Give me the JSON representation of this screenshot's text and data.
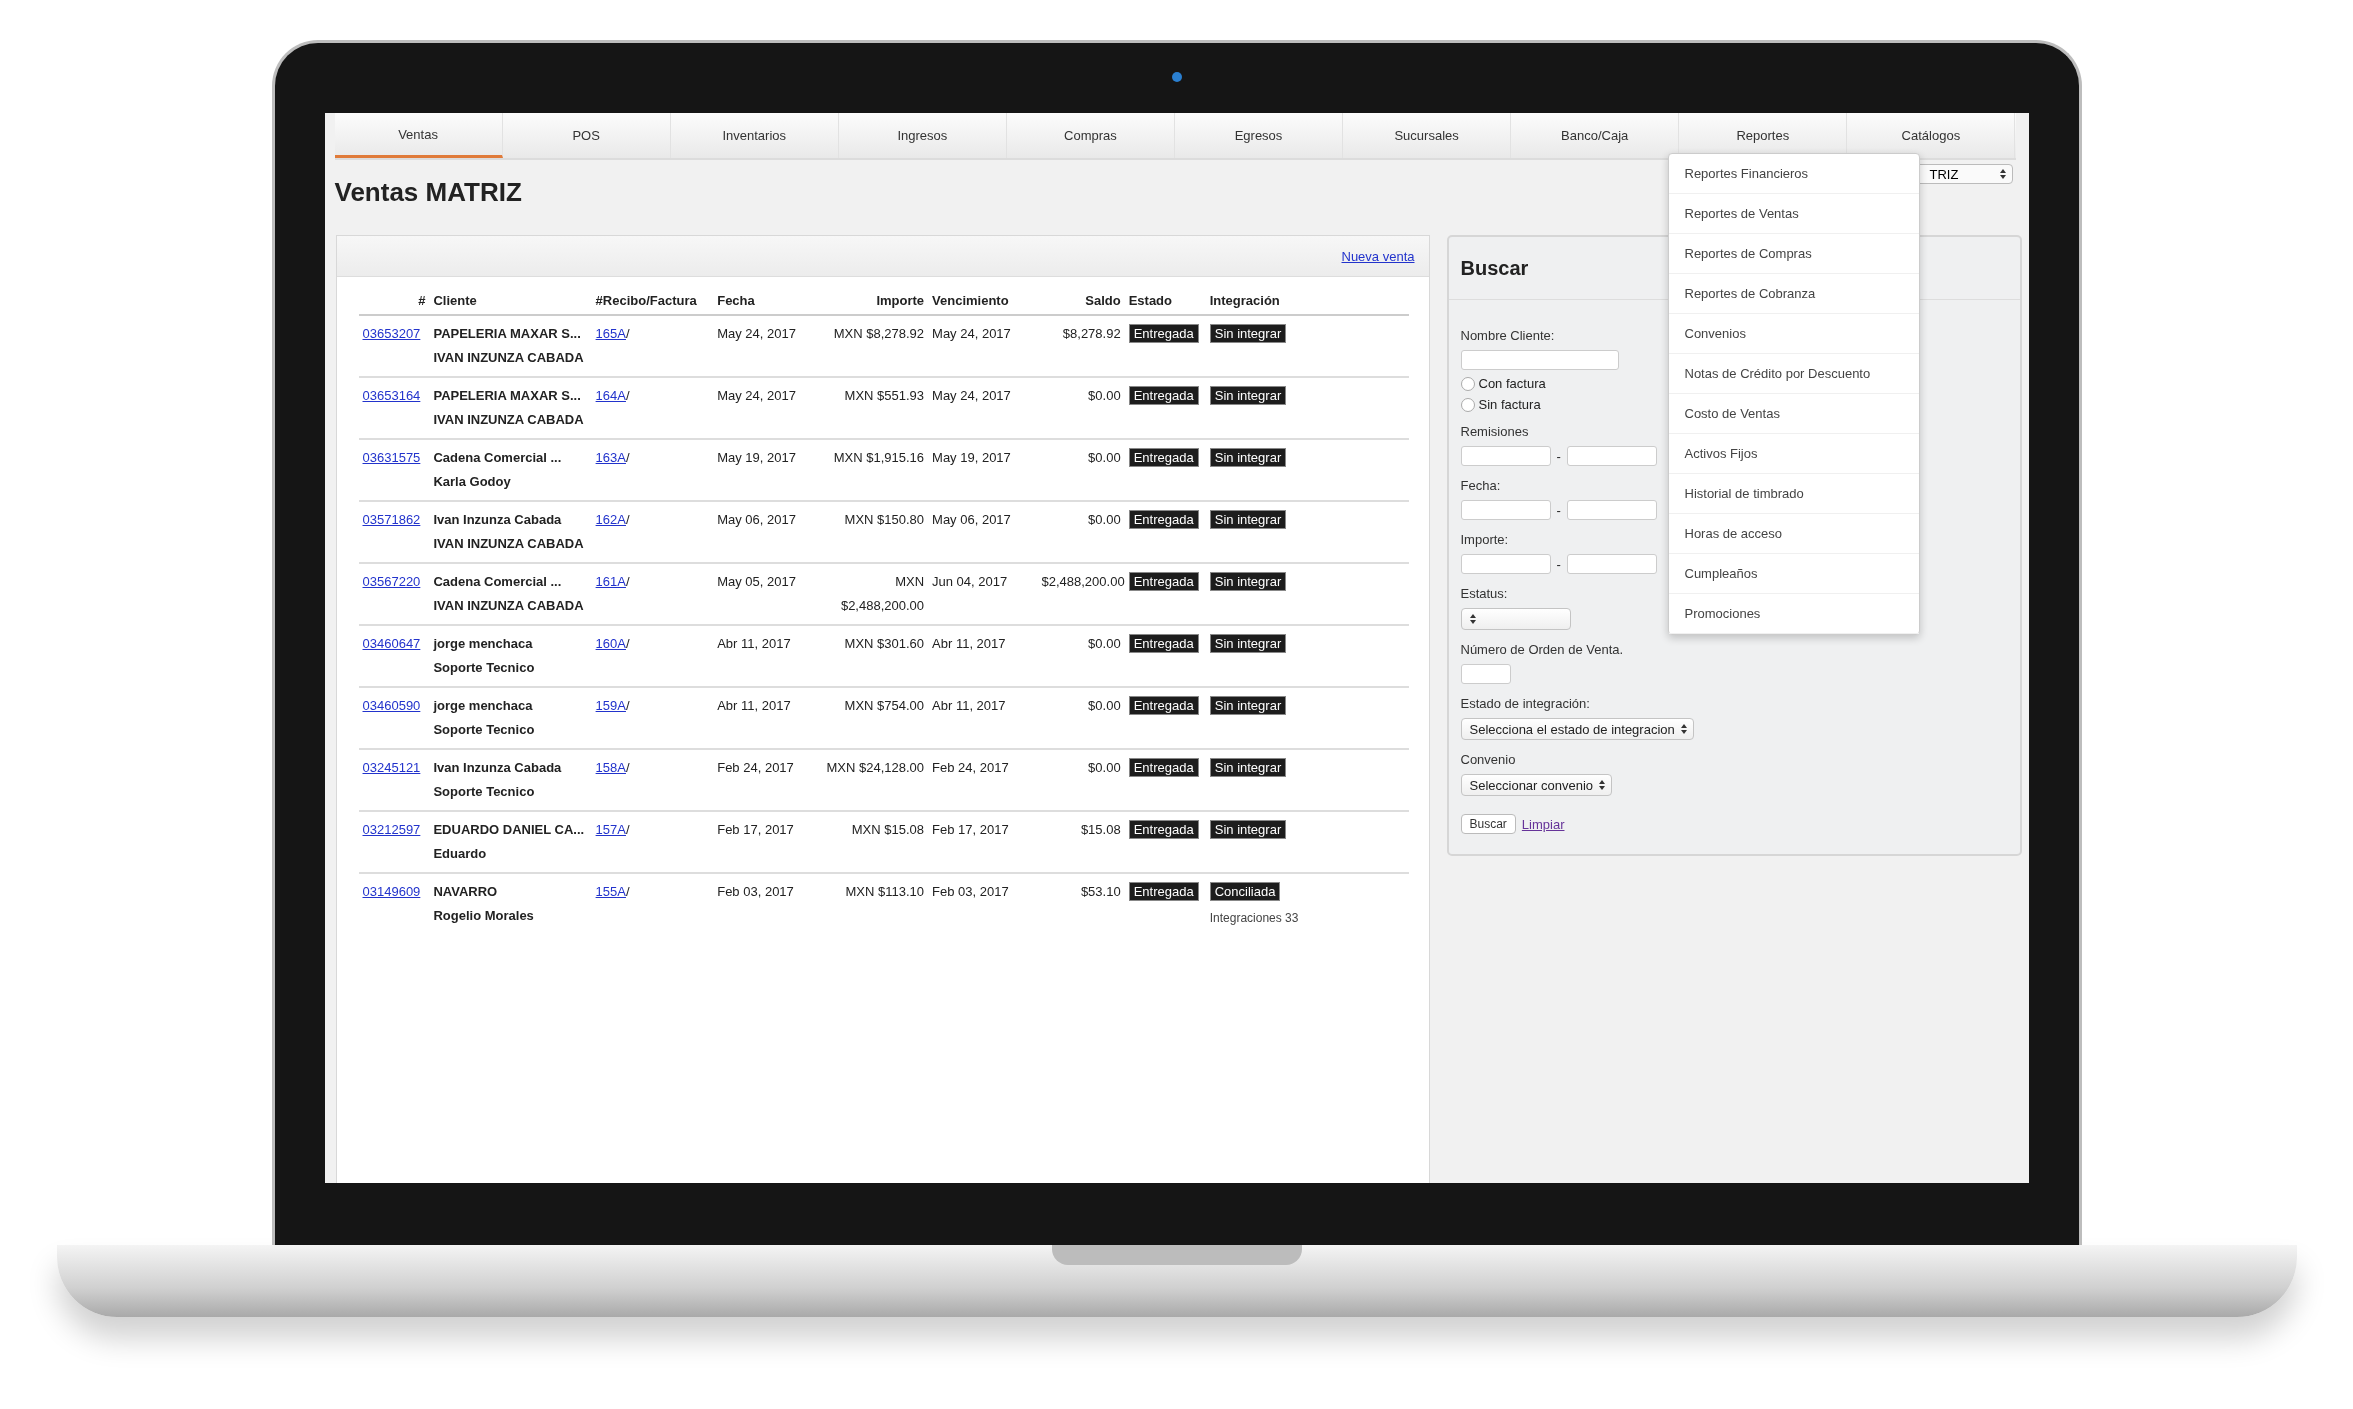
{
  "tabs": [
    {
      "label": "Ventas",
      "selected": true
    },
    {
      "label": "POS",
      "selected": false
    },
    {
      "label": "Inventarios",
      "selected": false
    },
    {
      "label": "Ingresos",
      "selected": false
    },
    {
      "label": "Compras",
      "selected": false
    },
    {
      "label": "Egresos",
      "selected": false
    },
    {
      "label": "Sucursales",
      "selected": false
    },
    {
      "label": "Banco/Caja",
      "selected": false
    },
    {
      "label": "Reportes",
      "selected": false
    },
    {
      "label": "Catálogos",
      "selected": false
    }
  ],
  "page_title": "Ventas MATRIZ",
  "branch_select": {
    "value": "TRIZ"
  },
  "reportes_menu": [
    "Reportes Financieros",
    "Reportes de Ventas",
    "Reportes de Compras",
    "Reportes de Cobranza",
    "Convenios",
    "Notas de Crédito por Descuento",
    "Costo de Ventas",
    "Activos Fijos",
    "Historial de timbrado",
    "Horas de acceso",
    "Cumpleaños",
    "Promociones"
  ],
  "sales_panel": {
    "new_sale_link": "Nueva venta",
    "columns": [
      "#",
      "Cliente",
      "#Recibo/Factura",
      "Fecha",
      "Importe",
      "Vencimiento",
      "Saldo",
      "Estado",
      "Integración"
    ],
    "rows": [
      {
        "id": "03653207",
        "cliente": [
          "PAPELERIA MAXAR S...",
          "IVAN INZUNZA CABADA"
        ],
        "recibo": "165A",
        "sep": "/",
        "fecha": "May 24, 2017",
        "importe": "MXN $8,278.92",
        "vencimiento": "May 24, 2017",
        "saldo": "$8,278.92",
        "estado": "Entregada",
        "integracion": "Sin integrar"
      },
      {
        "id": "03653164",
        "cliente": [
          "PAPELERIA MAXAR S...",
          "IVAN INZUNZA CABADA"
        ],
        "recibo": "164A",
        "sep": "/",
        "fecha": "May 24, 2017",
        "importe": "MXN $551.93",
        "vencimiento": "May 24, 2017",
        "saldo": "$0.00",
        "estado": "Entregada",
        "integracion": "Sin integrar"
      },
      {
        "id": "03631575",
        "cliente": [
          "Cadena Comercial ...",
          "Karla Godoy"
        ],
        "recibo": "163A",
        "sep": "/",
        "fecha": "May 19, 2017",
        "importe": "MXN $1,915.16",
        "vencimiento": "May 19, 2017",
        "saldo": "$0.00",
        "estado": "Entregada",
        "integracion": "Sin integrar"
      },
      {
        "id": "03571862",
        "cliente": [
          "Ivan Inzunza Cabada",
          "IVAN INZUNZA CABADA"
        ],
        "recibo": "162A",
        "sep": "/",
        "fecha": "May 06, 2017",
        "importe": "MXN $150.80",
        "vencimiento": "May 06, 2017",
        "saldo": "$0.00",
        "estado": "Entregada",
        "integracion": "Sin integrar"
      },
      {
        "id": "03567220",
        "cliente": [
          "Cadena Comercial ...",
          "IVAN INZUNZA CABADA"
        ],
        "recibo": "161A",
        "sep": "/",
        "fecha": "May 05, 2017",
        "importe": "MXN $2,488,200.00",
        "vencimiento": "Jun 04, 2017",
        "saldo": "$2,488,200.00",
        "estado": "Entregada",
        "integracion": "Sin integrar"
      },
      {
        "id": "03460647",
        "cliente": [
          "jorge menchaca",
          "Soporte Tecnico"
        ],
        "recibo": "160A",
        "sep": "/",
        "fecha": "Abr 11, 2017",
        "importe": "MXN $301.60",
        "vencimiento": "Abr 11, 2017",
        "saldo": "$0.00",
        "estado": "Entregada",
        "integracion": "Sin integrar"
      },
      {
        "id": "03460590",
        "cliente": [
          "jorge menchaca",
          "Soporte Tecnico"
        ],
        "recibo": "159A",
        "sep": "/",
        "fecha": "Abr 11, 2017",
        "importe": "MXN $754.00",
        "vencimiento": "Abr 11, 2017",
        "saldo": "$0.00",
        "estado": "Entregada",
        "integracion": "Sin integrar"
      },
      {
        "id": "03245121",
        "cliente": [
          "Ivan Inzunza Cabada",
          "Soporte Tecnico"
        ],
        "recibo": "158A",
        "sep": "/",
        "fecha": "Feb 24, 2017",
        "importe": "MXN $24,128.00",
        "vencimiento": "Feb 24, 2017",
        "saldo": "$0.00",
        "estado": "Entregada",
        "integracion": "Sin integrar"
      },
      {
        "id": "03212597",
        "cliente": [
          "EDUARDO DANIEL CA...",
          "Eduardo"
        ],
        "recibo": "157A",
        "sep": "/",
        "fecha": "Feb 17, 2017",
        "importe": "MXN $15.08",
        "vencimiento": "Feb 17, 2017",
        "saldo": "$15.08",
        "estado": "Entregada",
        "integracion": "Sin integrar"
      },
      {
        "id": "03149609",
        "cliente": [
          "NAVARRO",
          "Rogelio Morales"
        ],
        "recibo": "155A",
        "sep": "/",
        "fecha": "Feb 03, 2017",
        "importe": "MXN $113.10",
        "vencimiento": "Feb 03, 2017",
        "saldo": "$53.10",
        "estado": "Entregada",
        "integracion": "Conciliada"
      }
    ],
    "footer_note": "Integraciones 33"
  },
  "search_panel": {
    "title": "Buscar",
    "fields": [
      {
        "kind": "text",
        "label": "Nombre Cliente:"
      },
      {
        "kind": "radios",
        "options": [
          {
            "label": "Con factura",
            "selected": false
          },
          {
            "label": "Sin factura",
            "selected": false
          }
        ]
      },
      {
        "kind": "range",
        "label": "Remisiones",
        "separator": "-"
      },
      {
        "kind": "range",
        "label": "Fecha:",
        "separator": "-"
      },
      {
        "kind": "range",
        "label": "Importe:",
        "separator": "-"
      },
      {
        "kind": "select",
        "label": "Estatus:"
      },
      {
        "kind": "short",
        "label": "Número de Orden de Venta."
      },
      {
        "kind": "select",
        "label": "Estado de integración:",
        "value": "Selecciona el estado de integracion"
      },
      {
        "kind": "select",
        "label": "Convenio",
        "value": "Seleccionar convenio"
      }
    ],
    "search_button": "Buscar",
    "clear_link": "Limpiar"
  }
}
